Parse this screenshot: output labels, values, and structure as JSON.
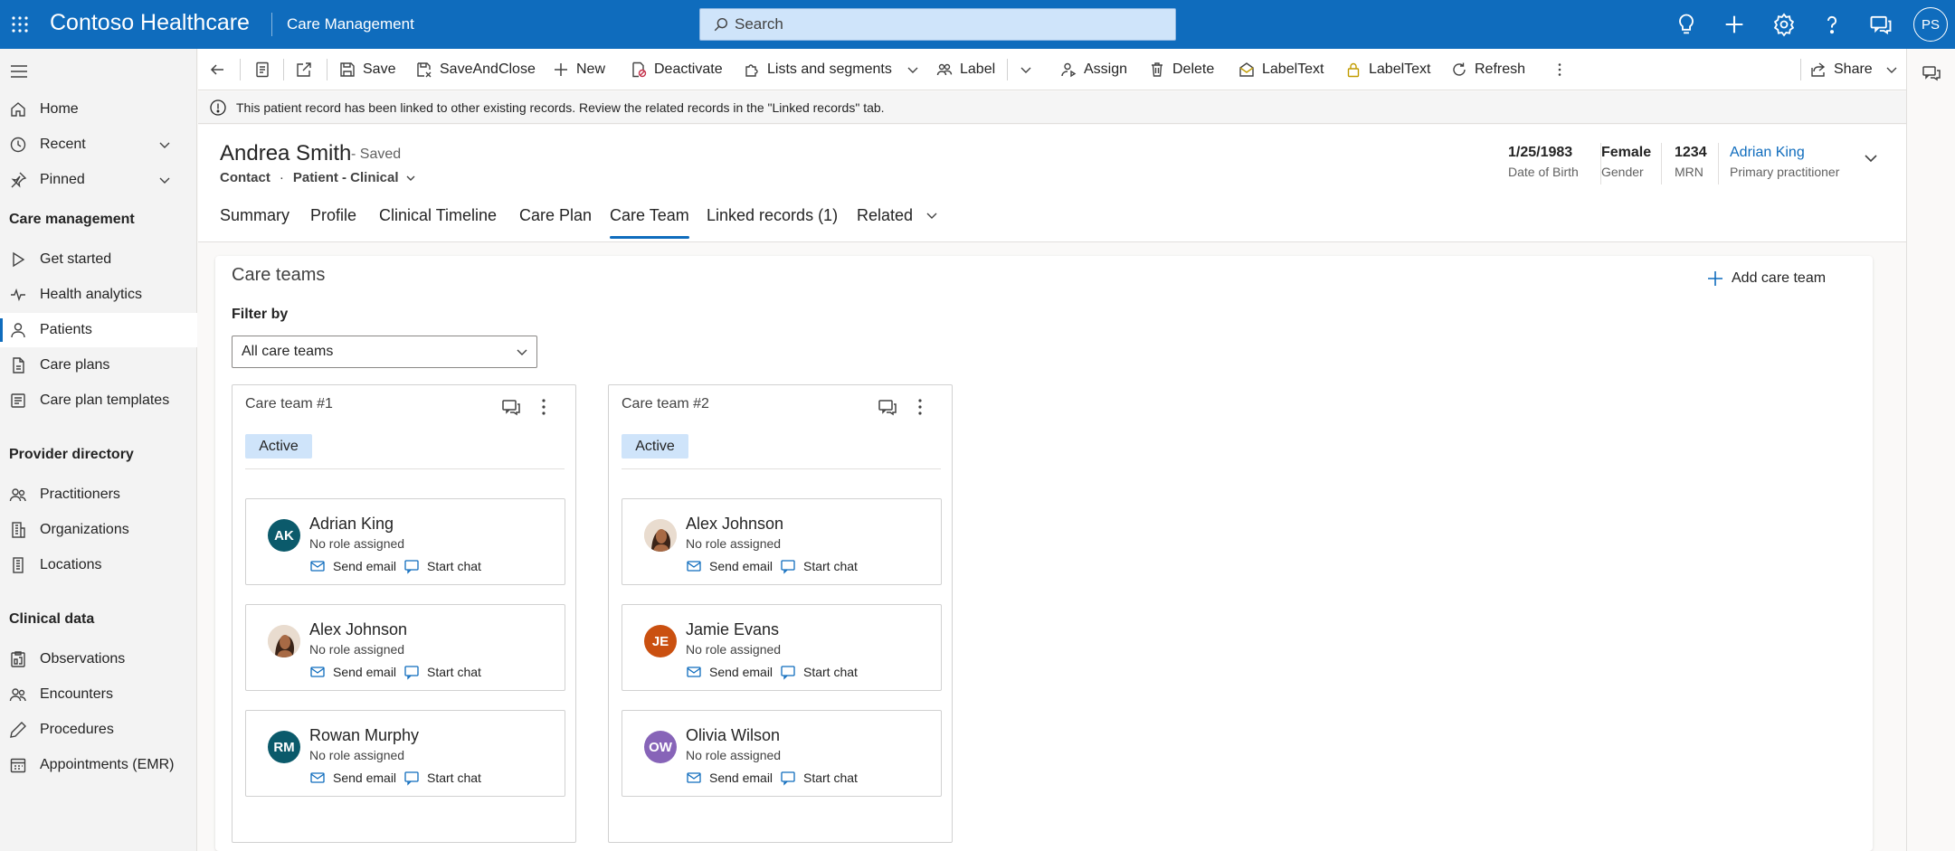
{
  "app": {
    "title": "Contoso Healthcare",
    "area": "Care Management",
    "search_placeholder": "Search",
    "user_initials": "PS"
  },
  "topbar_icons": [
    "lightbulb-icon",
    "plus-icon",
    "gear-icon",
    "help-icon",
    "chat-icon"
  ],
  "nav": {
    "items_top": [
      {
        "label": "Home",
        "icon": "home-icon"
      },
      {
        "label": "Recent",
        "icon": "clock-icon"
      },
      {
        "label": "Pinned",
        "icon": "pin-icon"
      }
    ],
    "groups": [
      {
        "title": "Care management",
        "items": [
          {
            "label": "Get started",
            "icon": "play-icon"
          },
          {
            "label": "Health analytics",
            "icon": "analytics-icon"
          },
          {
            "label": "Patients",
            "icon": "person-icon",
            "selected": true
          },
          {
            "label": "Care plans",
            "icon": "document-icon"
          },
          {
            "label": "Care plan templates",
            "icon": "template-icon"
          }
        ]
      },
      {
        "title": "Provider directory",
        "items": [
          {
            "label": "Practitioners",
            "icon": "people-icon"
          },
          {
            "label": "Organizations",
            "icon": "building-icon"
          },
          {
            "label": "Locations",
            "icon": "building-icon"
          }
        ]
      },
      {
        "title": "Clinical data",
        "items": [
          {
            "label": "Observations",
            "icon": "clipboard-icon"
          },
          {
            "label": "Encounters",
            "icon": "people-icon"
          },
          {
            "label": "Procedures",
            "icon": "pen-icon"
          },
          {
            "label": "Appointments (EMR)",
            "icon": "calendar-icon"
          }
        ]
      }
    ]
  },
  "commands": {
    "save": "Save",
    "save_and_close": "SaveAndClose",
    "new": "New",
    "deactivate": "Deactivate",
    "lists_and_segments": "Lists and segments",
    "label": "Label",
    "assign": "Assign",
    "delete": "Delete",
    "label_text_1": "LabelText",
    "label_text_2": "LabelText",
    "refresh": "Refresh",
    "share": "Share"
  },
  "notification": "This patient record has been linked to other existing records. Review the related records in the \"Linked records\" tab.",
  "record": {
    "name": "Andrea Smith",
    "status": "- Saved",
    "entity": "Contact",
    "form": "Patient - Clinical",
    "fields": [
      {
        "value": "1/25/1983",
        "label": "Date of Birth"
      },
      {
        "value": "Female",
        "label": "Gender"
      },
      {
        "value": "1234",
        "label": "MRN"
      },
      {
        "value": "Adrian King",
        "label": "Primary practitioner"
      }
    ]
  },
  "tabs": [
    "Summary",
    "Profile",
    "Clinical Timeline",
    "Care Plan",
    "Care Team",
    "Linked records (1)",
    "Related"
  ],
  "active_tab": "Care Team",
  "care_teams": {
    "section_title": "Care teams",
    "add_label": "Add care team",
    "filter_label": "Filter by",
    "filter_value": "All care teams",
    "teams": [
      {
        "name": "Care team #1",
        "status": "Active",
        "members": [
          {
            "name": "Adrian King",
            "role": "No role assigned",
            "initials": "AK",
            "avatar_color": "#0b5a6b",
            "photo": false
          },
          {
            "name": "Alex Johnson",
            "role": "No role assigned",
            "initials": "",
            "avatar_color": "#8a5a44",
            "photo": true
          },
          {
            "name": "Rowan Murphy",
            "role": "No role assigned",
            "initials": "RM",
            "avatar_color": "#0b5a6b",
            "photo": false
          }
        ]
      },
      {
        "name": "Care team #2",
        "status": "Active",
        "members": [
          {
            "name": "Alex Johnson",
            "role": "No role assigned",
            "initials": "",
            "avatar_color": "#8a5a44",
            "photo": true
          },
          {
            "name": "Jamie Evans",
            "role": "No role assigned",
            "initials": "JE",
            "avatar_color": "#ca5010",
            "photo": false
          },
          {
            "name": "Olivia Wilson",
            "role": "No role assigned",
            "initials": "OW",
            "avatar_color": "#8764b8",
            "photo": false
          }
        ]
      }
    ],
    "send_email": "Send email",
    "start_chat": "Start chat"
  },
  "colors": {
    "brand": "#0f6cbd",
    "badge_bg": "#cfe4fa"
  }
}
